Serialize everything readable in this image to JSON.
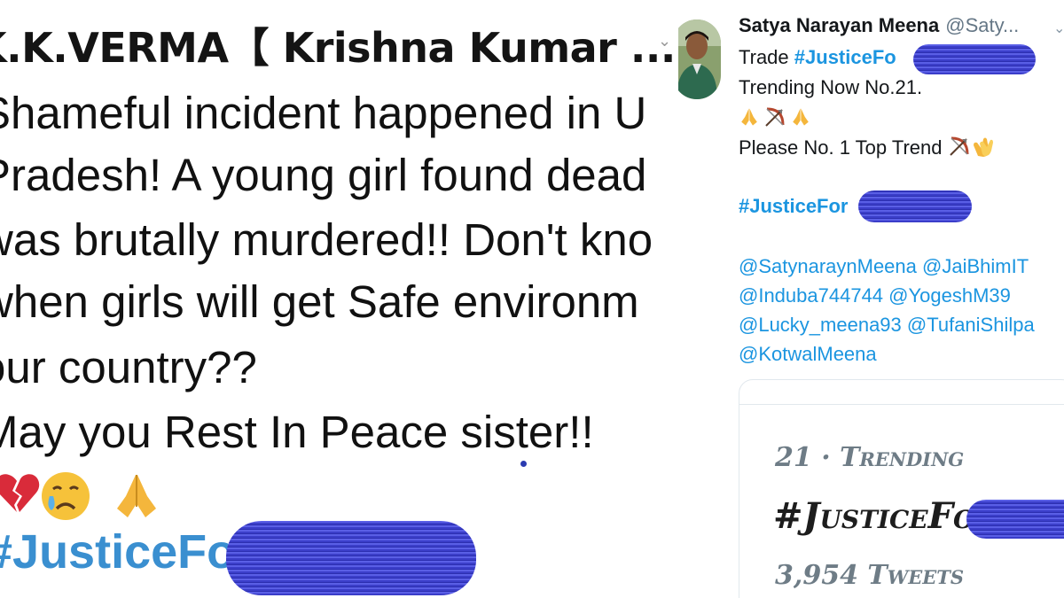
{
  "left_tweet": {
    "author": "K.K.VERMA【 Krishna Kumar ...",
    "lines": [
      "Shameful incident happened in U",
      "Pradesh! A young girl found dead",
      "was brutally murdered!! Don't kno",
      "when girls will get Safe environm",
      "our country??",
      "May you Rest In Peace sister!!"
    ],
    "emojis": [
      "broken-heart-emoji",
      "crying-face-emoji",
      "folded-hands-emoji"
    ],
    "hashtag": "#JusticeFor"
  },
  "right_tweet": {
    "author_name": "Satya Narayan Meena",
    "author_handle": "@Saty...",
    "line1_prefix": "Trade ",
    "line1_tag": "#JusticeFo",
    "line2": "Trending Now No.21.",
    "line4": "Please No. 1 Top Trend",
    "hashtag": "#JusticeFor",
    "mentions": [
      "@SatynaraynMeena @JaiBhimIT",
      "@Induba744744 @YogeshM39",
      "@Lucky_meena93 @TufaniShilpa",
      "@KotwalMeena"
    ],
    "emojis_line3": [
      "folded-hands-emoji",
      "bow-and-arrow-emoji",
      "folded-hands-emoji"
    ],
    "emojis_line4": [
      "bow-and-arrow-emoji",
      "clapping-hands-emoji"
    ],
    "trend_card": {
      "rank": "21 · Trending",
      "tag": "#JusticeFor",
      "tweets": "3,954 Tweets"
    }
  },
  "colors": {
    "hashtag_blue": "#1b95e0",
    "redaction_scribble": "#3b3ec9"
  }
}
